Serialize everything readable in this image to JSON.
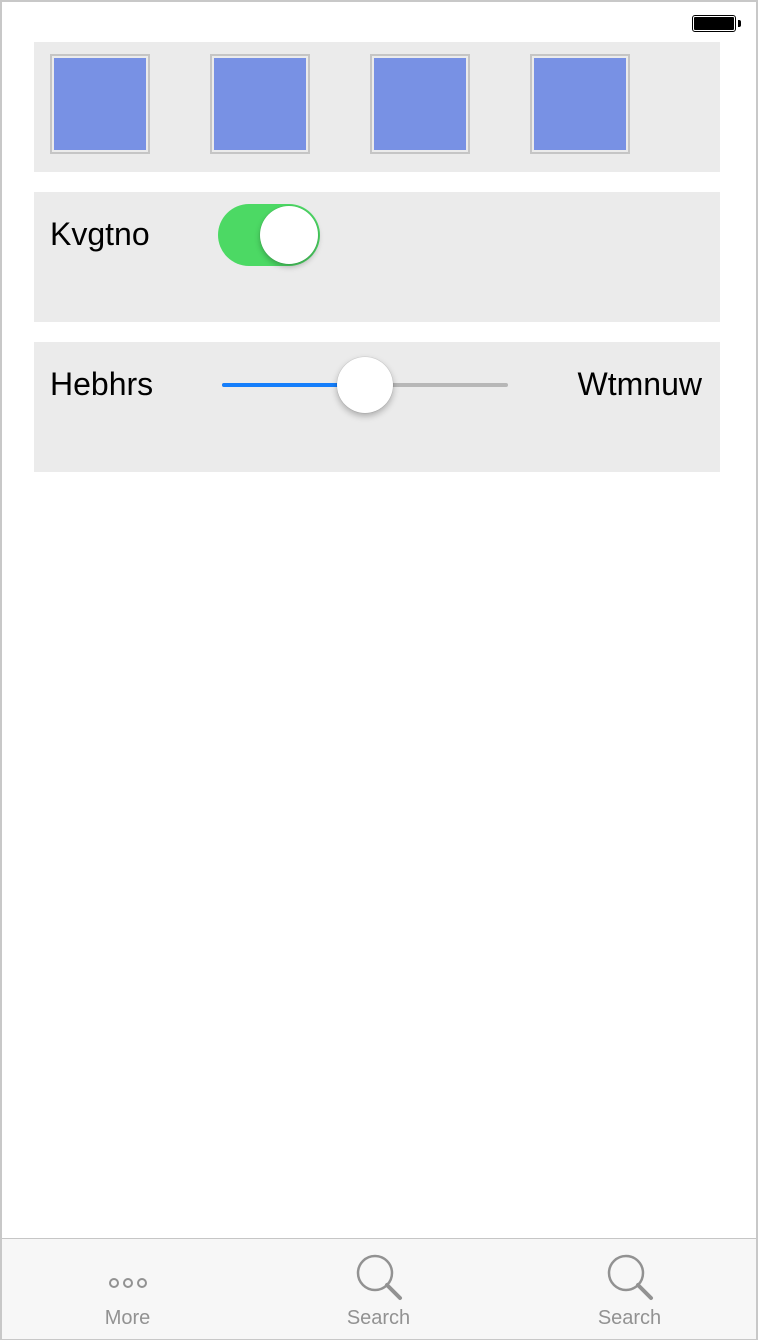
{
  "status_bar": {
    "battery_icon": "battery-full-icon"
  },
  "image_row": {
    "thumbnails": [
      {
        "icon": "image-placeholder",
        "color": "#7891e4"
      },
      {
        "icon": "image-placeholder",
        "color": "#7891e4"
      },
      {
        "icon": "image-placeholder",
        "color": "#7891e4"
      },
      {
        "icon": "image-placeholder",
        "color": "#7891e4"
      }
    ]
  },
  "switch_row": {
    "label": "Kvgtno",
    "on": true,
    "on_color": "#4cd964"
  },
  "slider_row": {
    "min_label": "Hebhrs",
    "max_label": "Wtmnuw",
    "value": 0.5,
    "accent_color": "#157efb"
  },
  "tab_bar": {
    "items": [
      {
        "label": "More",
        "icon": "more-icon"
      },
      {
        "label": "Search",
        "icon": "search-icon"
      },
      {
        "label": "Search",
        "icon": "search-icon"
      }
    ]
  }
}
